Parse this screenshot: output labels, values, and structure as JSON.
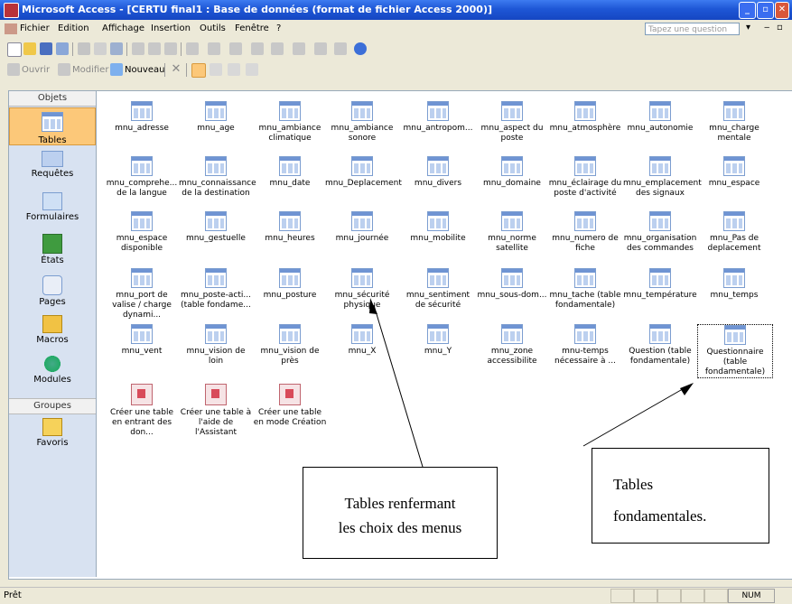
{
  "window": {
    "title": "Microsoft Access - [CERTU final1 : Base de données (format de fichier Access 2000)]"
  },
  "menu": [
    "Fichier",
    "Edition",
    "Affichage",
    "Insertion",
    "Outils",
    "Fenêtre",
    "?"
  ],
  "help_box": {
    "placeholder": "Tapez une question"
  },
  "toolbar2": {
    "open": "Ouvrir",
    "modify": "Modifier",
    "new": "Nouveau"
  },
  "left_pane": {
    "objects_header": "Objets",
    "items": [
      "Tables",
      "Requêtes",
      "Formulaires",
      "États",
      "Pages",
      "Macros",
      "Modules"
    ],
    "groups_header": "Groupes",
    "favorites": "Favoris"
  },
  "tables": [
    "mnu_adresse",
    "mnu_age",
    "mnu_ambiance climatique",
    "mnu_ambiance sonore",
    "mnu_antropom...",
    "mnu_aspect du poste",
    "mnu_atmosphère",
    "mnu_autonomie",
    "mnu_charge mentale",
    "mnu_comprehe... de la langue",
    "mnu_connaissance de la destination",
    "mnu_date",
    "mnu_Deplacement",
    "mnu_divers",
    "mnu_domaine",
    "mnu_éclairage du poste d'activité",
    "mnu_emplacement des signaux",
    "mnu_espace",
    "mnu_espace disponible",
    "mnu_gestuelle",
    "mnu_heures",
    "mnu_journée",
    "mnu_mobilite",
    "mnu_norme satellite",
    "mnu_numero de fiche",
    "mnu_organisation des commandes",
    "mnu_Pas de deplacement",
    "mnu_port de valise / charge dynami...",
    "mnu_poste-acti... (table fondame...",
    "mnu_posture",
    "mnu_sécurité physique",
    "mnu_sentiment de sécurité",
    "mnu_sous-dom...",
    "mnu_tache (table fondamentale)",
    "mnu_température",
    "mnu_temps",
    "mnu_vent",
    "mnu_vision de loin",
    "mnu_vision de près",
    "mnu_X",
    "mnu_Y",
    "mnu_zone accessibilite",
    "mnu-temps nécessaire à ...",
    "Question (table fondamentale)",
    "Questionnaire (table fondamentale)"
  ],
  "wizards": [
    "Créer une table en entrant des don...",
    "Créer une table à l'aide de l'Assistant",
    "Créer une table en mode Création"
  ],
  "annotations": {
    "menus_box": [
      "Tables renfermant",
      "les choix des menus"
    ],
    "fundamental_box": [
      "Tables",
      "fondamentales."
    ]
  },
  "status": {
    "left": "Prêt",
    "num": "NUM"
  }
}
